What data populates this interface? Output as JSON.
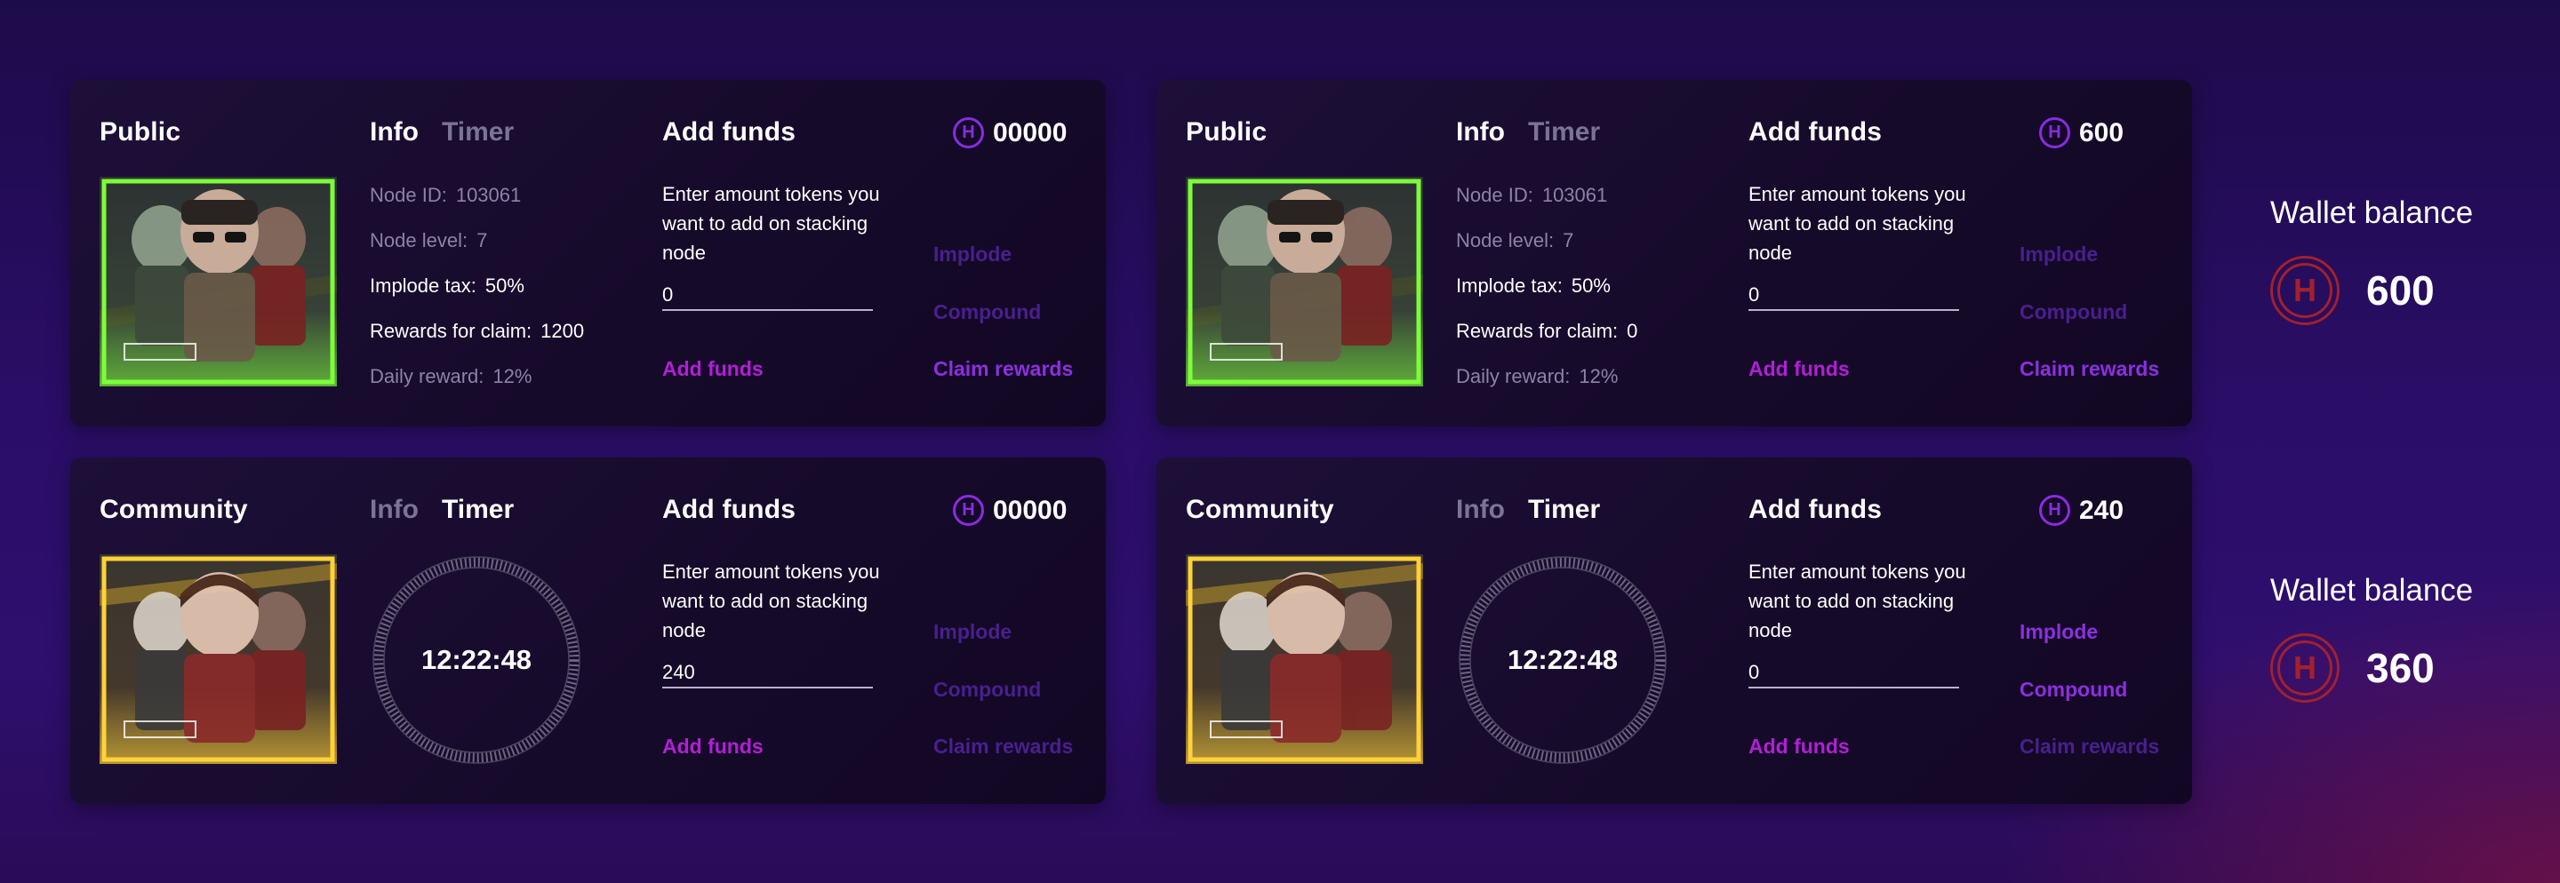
{
  "cards": [
    {
      "title": "Public",
      "tabs": {
        "info": "Info",
        "timer": "Timer"
      },
      "info": {
        "node_id_label": "Node ID:",
        "node_id": "103061",
        "node_level_label": "Node level:",
        "node_level": "7",
        "implode_tax_label": "Implode tax:",
        "implode_tax": "50%",
        "rewards_label": "Rewards for claim:",
        "rewards": "1200",
        "daily_reward_label": "Daily reward:",
        "daily_reward": "12%"
      },
      "add_funds_title": "Add funds",
      "description": "Enter amount tokens you want to add on stacking node",
      "input_value": "0",
      "add_funds_link": "Add funds",
      "token_amount": "00000",
      "token_icon": "H",
      "implode": "Implode",
      "compound": "Compound",
      "claim_rewards": "Claim rewards"
    },
    {
      "title": "Public",
      "tabs": {
        "info": "Info",
        "timer": "Timer"
      },
      "info": {
        "node_id_label": "Node ID:",
        "node_id": "103061",
        "node_level_label": "Node level:",
        "node_level": "7",
        "implode_tax_label": "Implode tax:",
        "implode_tax": "50%",
        "rewards_label": "Rewards for claim:",
        "rewards": "0",
        "daily_reward_label": "Daily reward:",
        "daily_reward": "12%"
      },
      "add_funds_title": "Add funds",
      "description": "Enter amount tokens you want to add on stacking node",
      "input_value": "0",
      "add_funds_link": "Add funds",
      "token_amount": "600",
      "token_icon": "H",
      "implode": "Implode",
      "compound": "Compound",
      "claim_rewards": "Claim rewards"
    },
    {
      "title": "Community",
      "tabs": {
        "info": "Info",
        "timer": "Timer"
      },
      "timer": "12:22:48",
      "add_funds_title": "Add funds",
      "description": "Enter amount tokens you want to add on stacking node",
      "input_value": "240",
      "add_funds_link": "Add funds",
      "token_amount": "00000",
      "token_icon": "H",
      "implode": "Implode",
      "compound": "Compound",
      "claim_rewards": "Claim rewards"
    },
    {
      "title": "Community",
      "tabs": {
        "info": "Info",
        "timer": "Timer"
      },
      "timer": "12:22:48",
      "add_funds_title": "Add funds",
      "description": "Enter amount tokens you want to add on stacking node",
      "input_value": "0",
      "add_funds_link": "Add funds",
      "token_amount": "240",
      "token_icon": "H",
      "implode": "Implode",
      "compound": "Compound",
      "claim_rewards": "Claim rewards"
    }
  ],
  "wallets": [
    {
      "title": "Wallet balance",
      "amount": "600",
      "icon": "H"
    },
    {
      "title": "Wallet balance",
      "amount": "360",
      "icon": "H"
    }
  ],
  "colors": {
    "accent_magenta": "#b21fd6",
    "accent_purple": "#8c2fe0",
    "faint_purple": "#4a1f8f",
    "wallet_red": "#a3202c",
    "frame_green": "#7cff3a",
    "frame_yellow": "#ffd23a"
  },
  "icons": {
    "token": "hex-token-icon",
    "wallet": "hex-coin-icon"
  }
}
